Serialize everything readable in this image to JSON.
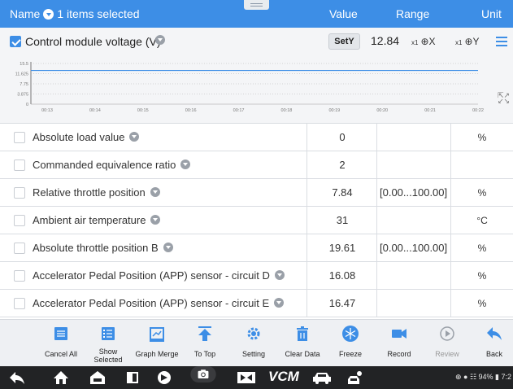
{
  "header": {
    "name_label": "Name",
    "selection_label": "1 items selected",
    "value_label": "Value",
    "range_label": "Range",
    "unit_label": "Unit"
  },
  "graph_item": {
    "name": "Control module voltage   (V)",
    "sety_label": "SetY",
    "value": "12.84",
    "zoom_x_sub": "x1",
    "zoom_x_label": "⊕X",
    "zoom_y_sub": "x1",
    "zoom_y_label": "⊕Y"
  },
  "chart_data": {
    "type": "line",
    "y_ticks": [
      "15.5",
      "11.625",
      "7.75",
      "3.875",
      "0"
    ],
    "x_ticks": [
      "00:13",
      "00:14",
      "00:15",
      "00:16",
      "00:17",
      "00:18",
      "00:19",
      "00:20",
      "00:21",
      "00:22"
    ],
    "ylim": [
      0,
      15.5
    ],
    "series": [
      {
        "values": [
          12.84,
          12.84
        ]
      }
    ],
    "line_color": "#3d8ee6"
  },
  "rows": [
    {
      "name": "Absolute load value",
      "value": "0",
      "range": "",
      "unit": "%"
    },
    {
      "name": "Commanded equivalence ratio",
      "value": "2",
      "range": "",
      "unit": ""
    },
    {
      "name": "Relative throttle position",
      "value": "7.84",
      "range": "[0.00...100.00]",
      "unit": "%"
    },
    {
      "name": "Ambient air temperature",
      "value": "31",
      "range": "",
      "unit": "°C"
    },
    {
      "name": "Absolute throttle position B",
      "value": "19.61",
      "range": "[0.00...100.00]",
      "unit": "%"
    },
    {
      "name": "Accelerator Pedal Position (APP) sensor - circuit D",
      "value": "16.08",
      "range": "",
      "unit": "%"
    },
    {
      "name": "Accelerator Pedal Position (APP) sensor - circuit E",
      "value": "16.47",
      "range": "",
      "unit": "%"
    }
  ],
  "toolbar": {
    "cancel_all": "Cancel All",
    "show_selected_1": "Show",
    "show_selected_2": "Selected",
    "graph_merge": "Graph Merge",
    "to_top": "To Top",
    "setting": "Setting",
    "clear_data": "Clear Data",
    "freeze": "Freeze",
    "record": "Record",
    "review": "Review",
    "back": "Back"
  },
  "navbar": {
    "vcm_label": "VCM",
    "status_text": "⊕ ● ☷ 94% ▮ 7:2"
  },
  "colors": {
    "accent": "#3d8ee6",
    "toolbar_bg": "#eef0f3",
    "navbar_bg": "#222325"
  }
}
